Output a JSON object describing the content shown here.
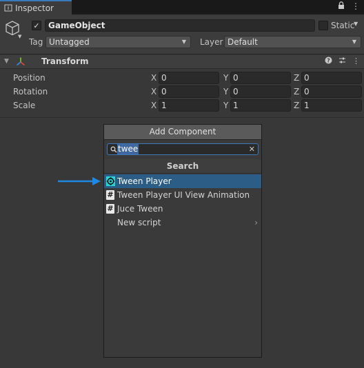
{
  "tab": {
    "title": "Inspector"
  },
  "gameobject": {
    "active": true,
    "name": "GameObject",
    "static_label": "Static",
    "tag_label": "Tag",
    "tag_value": "Untagged",
    "layer_label": "Layer",
    "layer_value": "Default"
  },
  "transform": {
    "title": "Transform",
    "rows": [
      {
        "label": "Position",
        "x": "0",
        "y": "0",
        "z": "0"
      },
      {
        "label": "Rotation",
        "x": "0",
        "y": "0",
        "z": "0"
      },
      {
        "label": "Scale",
        "x": "1",
        "y": "1",
        "z": "1"
      }
    ],
    "axes": {
      "x": "X",
      "y": "Y",
      "z": "Z"
    }
  },
  "add_component": {
    "button_label": "Add Component",
    "search_query": "twee",
    "section_title": "Search",
    "items": [
      {
        "label": "Tween Player",
        "icon": "tween-player-icon",
        "selected": true
      },
      {
        "label": "Tween Player UI View Animation",
        "icon": "script-hash-icon"
      },
      {
        "label": "Juce Tween",
        "icon": "script-hash-icon"
      },
      {
        "label": "New script",
        "icon": "",
        "submenu": true
      }
    ]
  },
  "colors": {
    "accent": "#3a79bb",
    "selection": "#2c5d87",
    "pointer_arrow": "#1e88e5"
  }
}
